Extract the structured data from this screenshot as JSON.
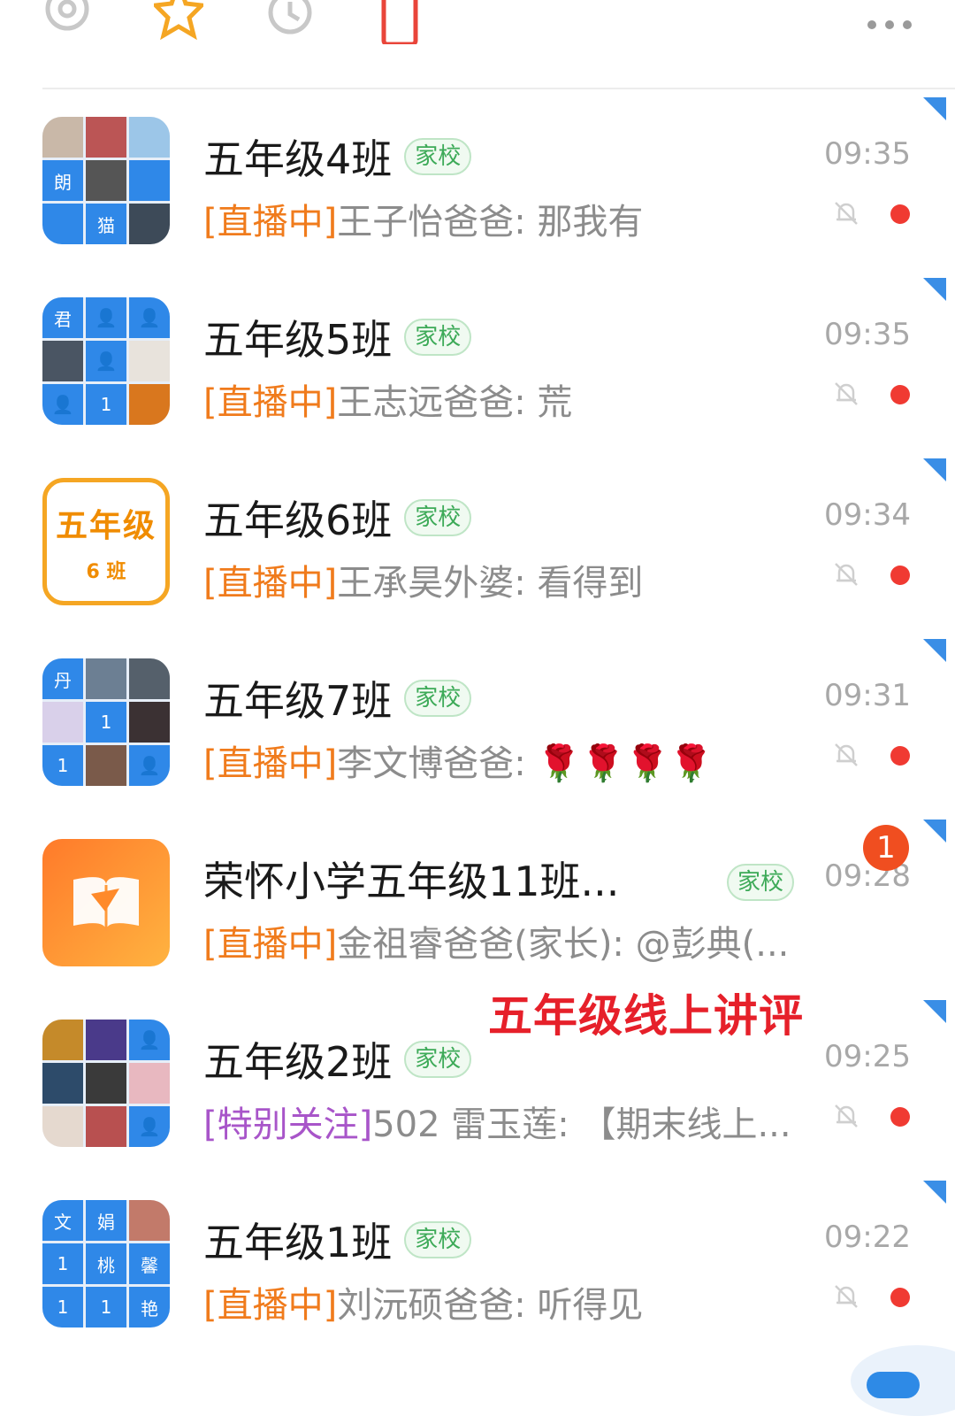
{
  "toolbar": {
    "icons": [
      "at-icon",
      "star-icon",
      "history-icon",
      "document-icon",
      "more-icon"
    ]
  },
  "chats": [
    {
      "title": "五年级4班",
      "badge": "家校",
      "time": "09:35",
      "tag": "[直播中]",
      "message": "王子怡爸爸: 那我有",
      "tag_color": "orange",
      "status": "muted-unread"
    },
    {
      "title": "五年级5班",
      "badge": "家校",
      "time": "09:35",
      "tag": "[直播中]",
      "message": "王志远爸爸: 荒",
      "tag_color": "orange",
      "status": "muted-unread"
    },
    {
      "title": "五年级6班",
      "badge": "家校",
      "time": "09:34",
      "tag": "[直播中]",
      "message": "王承昊外婆: 看得到",
      "tag_color": "orange",
      "status": "muted-unread",
      "avatar_text": [
        "五年级",
        "6 班"
      ]
    },
    {
      "title": "五年级7班",
      "badge": "家校",
      "time": "09:31",
      "tag": "[直播中]",
      "message": "李文博爸爸: 🌹🌹🌹🌹",
      "tag_color": "orange",
      "status": "muted-unread"
    },
    {
      "title": "荣怀小学五年级11班...",
      "badge": "家校",
      "time": "09:28",
      "tag": "[直播中]",
      "message": "金祖睿爸爸(家长): @彭典(...",
      "tag_color": "orange",
      "status": "count",
      "count": "1"
    },
    {
      "title": "五年级2班",
      "badge": "家校",
      "time": "09:25",
      "tag": "[特别关注]",
      "message": "502 雷玉莲: 【期末线上...",
      "tag_color": "purple",
      "status": "muted-unread"
    },
    {
      "title": "五年级1班",
      "badge": "家校",
      "time": "09:22",
      "tag": "[直播中]",
      "message": "刘沅硕爸爸: 听得见",
      "tag_color": "orange",
      "status": "muted-unread"
    }
  ],
  "avatars": {
    "a0": [
      "",
      "",
      "",
      "朗",
      "",
      "",
      "",
      "猫",
      ""
    ],
    "a1": [
      "君",
      "",
      "",
      "",
      "",
      "",
      "",
      "1",
      ""
    ],
    "a3": [
      "丹",
      "",
      "",
      "",
      "1",
      "",
      "1",
      "",
      ""
    ],
    "a5": [
      "",
      "",
      "",
      "",
      "",
      "",
      "",
      "",
      ""
    ],
    "a6": [
      "文",
      "娟",
      "",
      "1",
      "桃",
      "馨",
      "1",
      "1",
      "艳"
    ]
  },
  "overlay_caption": "五年级线上讲评",
  "colors": {
    "accent_orange": "#f07b1c",
    "accent_purple": "#a855c9",
    "badge_green": "#3daa58",
    "unread_red": "#f03a32",
    "pin_blue": "#3a8ee6"
  }
}
